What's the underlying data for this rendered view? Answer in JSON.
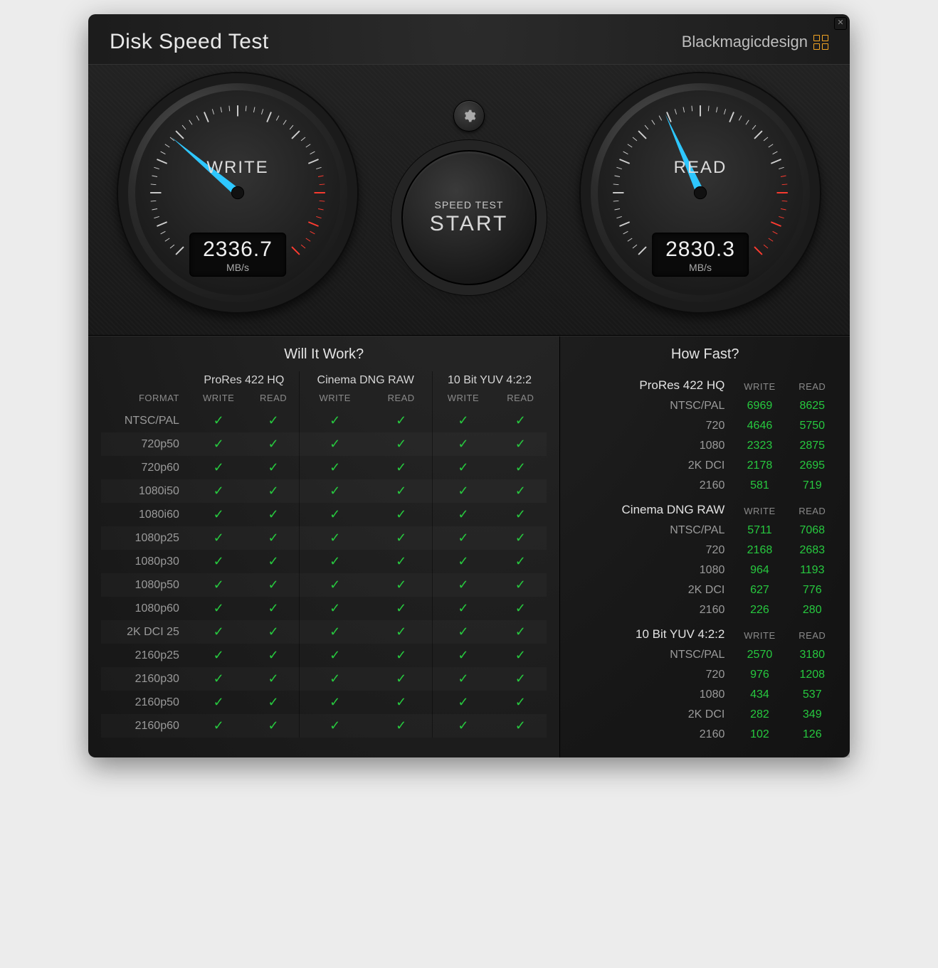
{
  "app_title": "Disk Speed Test",
  "brand": "Blackmagicdesign",
  "close_glyph": "✕",
  "settings_icon": "gear-icon",
  "start_button": {
    "line1": "SPEED TEST",
    "line2": "START"
  },
  "gauge_unit": "MB/s",
  "gauges": {
    "write": {
      "label": "WRITE",
      "value": "2336.7",
      "needle_deg": -50
    },
    "read": {
      "label": "READ",
      "value": "2830.3",
      "needle_deg": -24
    }
  },
  "tables": {
    "will_it_work": {
      "title": "Will It Work?",
      "format_label": "FORMAT",
      "wr_labels": {
        "write": "WRITE",
        "read": "READ"
      },
      "codec_headers": [
        "ProRes 422 HQ",
        "Cinema DNG RAW",
        "10 Bit YUV 4:2:2"
      ],
      "rows": [
        {
          "format": "NTSC/PAL",
          "cells": [
            true,
            true,
            true,
            true,
            true,
            true
          ]
        },
        {
          "format": "720p50",
          "cells": [
            true,
            true,
            true,
            true,
            true,
            true
          ]
        },
        {
          "format": "720p60",
          "cells": [
            true,
            true,
            true,
            true,
            true,
            true
          ]
        },
        {
          "format": "1080i50",
          "cells": [
            true,
            true,
            true,
            true,
            true,
            true
          ]
        },
        {
          "format": "1080i60",
          "cells": [
            true,
            true,
            true,
            true,
            true,
            true
          ]
        },
        {
          "format": "1080p25",
          "cells": [
            true,
            true,
            true,
            true,
            true,
            true
          ]
        },
        {
          "format": "1080p30",
          "cells": [
            true,
            true,
            true,
            true,
            true,
            true
          ]
        },
        {
          "format": "1080p50",
          "cells": [
            true,
            true,
            true,
            true,
            true,
            true
          ]
        },
        {
          "format": "1080p60",
          "cells": [
            true,
            true,
            true,
            true,
            true,
            true
          ]
        },
        {
          "format": "2K DCI 25",
          "cells": [
            true,
            true,
            true,
            true,
            true,
            true
          ]
        },
        {
          "format": "2160p25",
          "cells": [
            true,
            true,
            true,
            true,
            true,
            true
          ]
        },
        {
          "format": "2160p30",
          "cells": [
            true,
            true,
            true,
            true,
            true,
            true
          ]
        },
        {
          "format": "2160p50",
          "cells": [
            true,
            true,
            true,
            true,
            true,
            true
          ]
        },
        {
          "format": "2160p60",
          "cells": [
            true,
            true,
            true,
            true,
            true,
            true
          ]
        }
      ]
    },
    "how_fast": {
      "title": "How Fast?",
      "wr_labels": {
        "write": "WRITE",
        "read": "READ"
      },
      "groups": [
        {
          "name": "ProRes 422 HQ",
          "rows": [
            {
              "format": "NTSC/PAL",
              "write": 6969,
              "read": 8625
            },
            {
              "format": "720",
              "write": 4646,
              "read": 5750
            },
            {
              "format": "1080",
              "write": 2323,
              "read": 2875
            },
            {
              "format": "2K DCI",
              "write": 2178,
              "read": 2695
            },
            {
              "format": "2160",
              "write": 581,
              "read": 719
            }
          ]
        },
        {
          "name": "Cinema DNG RAW",
          "rows": [
            {
              "format": "NTSC/PAL",
              "write": 5711,
              "read": 7068
            },
            {
              "format": "720",
              "write": 2168,
              "read": 2683
            },
            {
              "format": "1080",
              "write": 964,
              "read": 1193
            },
            {
              "format": "2K DCI",
              "write": 627,
              "read": 776
            },
            {
              "format": "2160",
              "write": 226,
              "read": 280
            }
          ]
        },
        {
          "name": "10 Bit YUV 4:2:2",
          "rows": [
            {
              "format": "NTSC/PAL",
              "write": 2570,
              "read": 3180
            },
            {
              "format": "720",
              "write": 976,
              "read": 1208
            },
            {
              "format": "1080",
              "write": 434,
              "read": 537
            },
            {
              "format": "2K DCI",
              "write": 282,
              "read": 349
            },
            {
              "format": "2160",
              "write": 102,
              "read": 126
            }
          ]
        }
      ]
    }
  }
}
